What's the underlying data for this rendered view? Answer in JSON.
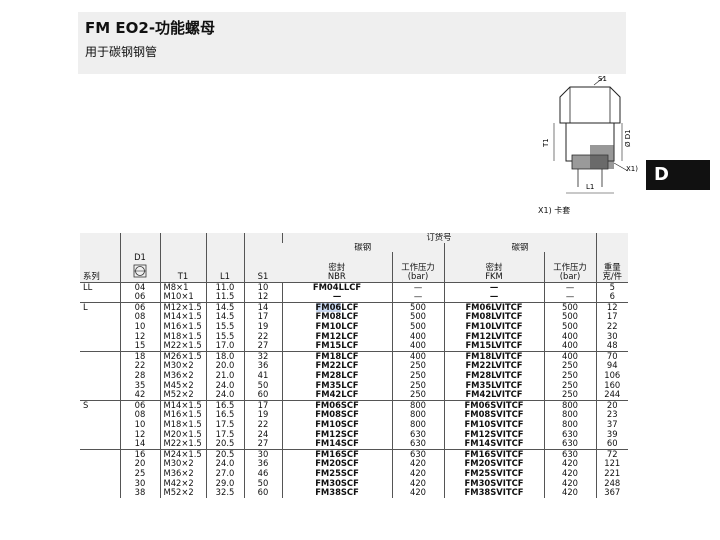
{
  "header": {
    "title": "FM EO2-功能螺母",
    "subtitle": "用于碳钢钢管"
  },
  "section_tab": "D",
  "drawing": {
    "labels": {
      "s1": "S1",
      "t1": "T1",
      "d1": "Ø D1",
      "l1": "L1",
      "x1": "X1)"
    },
    "note": "X1) 卡套"
  },
  "table": {
    "headers": {
      "order_no": "订货号",
      "carbon_steel_left": "碳钢",
      "carbon_steel_right": "碳钢",
      "series": "系列",
      "d1": "D1",
      "t1": "T1",
      "l1": "L1",
      "s1": "S1",
      "seal_nbr_1": "密封",
      "seal_nbr_2": "NBR",
      "pressure_1": "工作压力",
      "pressure_2": "(bar)",
      "seal_fkm_1": "密封",
      "seal_fkm_2": "FKM",
      "pressure_fkm_1": "工作压力",
      "pressure_fkm_2": "(bar)",
      "weight_1": "重量",
      "weight_2": "克/件"
    },
    "rows": [
      {
        "series": "LL",
        "d1": "04",
        "t1": "M8×1",
        "l1": "11.0",
        "s1": "10",
        "nbr": "FM04LLCF",
        "p1": "—",
        "fkm": "—",
        "p2": "—",
        "w": "5"
      },
      {
        "series": "",
        "d1": "06",
        "t1": "M10×1",
        "l1": "11.5",
        "s1": "12",
        "nbr": "—",
        "p1": "—",
        "fkm": "—",
        "p2": "—",
        "w": "6"
      },
      {
        "series": "L",
        "d1": "06",
        "t1": "M12×1.5",
        "l1": "14.5",
        "s1": "14",
        "nbr": "FM06LCF",
        "p1": "500",
        "fkm": "FM06LVITCF",
        "p2": "500",
        "w": "12"
      },
      {
        "series": "",
        "d1": "08",
        "t1": "M14×1.5",
        "l1": "14.5",
        "s1": "17",
        "nbr": "FM08LCF",
        "p1": "500",
        "fkm": "FM08LVITCF",
        "p2": "500",
        "w": "17"
      },
      {
        "series": "",
        "d1": "10",
        "t1": "M16×1.5",
        "l1": "15.5",
        "s1": "19",
        "nbr": "FM10LCF",
        "p1": "500",
        "fkm": "FM10LVITCF",
        "p2": "500",
        "w": "22"
      },
      {
        "series": "",
        "d1": "12",
        "t1": "M18×1.5",
        "l1": "15.5",
        "s1": "22",
        "nbr": "FM12LCF",
        "p1": "400",
        "fkm": "FM12LVITCF",
        "p2": "400",
        "w": "30"
      },
      {
        "series": "",
        "d1": "15",
        "t1": "M22×1.5",
        "l1": "17.0",
        "s1": "27",
        "nbr": "FM15LCF",
        "p1": "400",
        "fkm": "FM15LVITCF",
        "p2": "400",
        "w": "48"
      },
      {
        "series": "",
        "d1": "18",
        "t1": "M26×1.5",
        "l1": "18.0",
        "s1": "32",
        "nbr": "FM18LCF",
        "p1": "400",
        "fkm": "FM18LVITCF",
        "p2": "400",
        "w": "70"
      },
      {
        "series": "",
        "d1": "22",
        "t1": "M30×2",
        "l1": "20.0",
        "s1": "36",
        "nbr": "FM22LCF",
        "p1": "250",
        "fkm": "FM22LVITCF",
        "p2": "250",
        "w": "94"
      },
      {
        "series": "",
        "d1": "28",
        "t1": "M36×2",
        "l1": "21.0",
        "s1": "41",
        "nbr": "FM28LCF",
        "p1": "250",
        "fkm": "FM28LVITCF",
        "p2": "250",
        "w": "106"
      },
      {
        "series": "",
        "d1": "35",
        "t1": "M45×2",
        "l1": "24.0",
        "s1": "50",
        "nbr": "FM35LCF",
        "p1": "250",
        "fkm": "FM35LVITCF",
        "p2": "250",
        "w": "160"
      },
      {
        "series": "",
        "d1": "42",
        "t1": "M52×2",
        "l1": "24.0",
        "s1": "60",
        "nbr": "FM42LCF",
        "p1": "250",
        "fkm": "FM42LVITCF",
        "p2": "250",
        "w": "244"
      },
      {
        "series": "S",
        "d1": "06",
        "t1": "M14×1.5",
        "l1": "16.5",
        "s1": "17",
        "nbr": "FM06SCF",
        "p1": "800",
        "fkm": "FM06SVITCF",
        "p2": "800",
        "w": "20"
      },
      {
        "series": "",
        "d1": "08",
        "t1": "M16×1.5",
        "l1": "16.5",
        "s1": "19",
        "nbr": "FM08SCF",
        "p1": "800",
        "fkm": "FM08SVITCF",
        "p2": "800",
        "w": "23"
      },
      {
        "series": "",
        "d1": "10",
        "t1": "M18×1.5",
        "l1": "17.5",
        "s1": "22",
        "nbr": "FM10SCF",
        "p1": "800",
        "fkm": "FM10SVITCF",
        "p2": "800",
        "w": "37"
      },
      {
        "series": "",
        "d1": "12",
        "t1": "M20×1.5",
        "l1": "17.5",
        "s1": "24",
        "nbr": "FM12SCF",
        "p1": "630",
        "fkm": "FM12SVITCF",
        "p2": "630",
        "w": "39"
      },
      {
        "series": "",
        "d1": "14",
        "t1": "M22×1.5",
        "l1": "20.5",
        "s1": "27",
        "nbr": "FM14SCF",
        "p1": "630",
        "fkm": "FM14SVITCF",
        "p2": "630",
        "w": "60"
      },
      {
        "series": "",
        "d1": "16",
        "t1": "M24×1.5",
        "l1": "20.5",
        "s1": "30",
        "nbr": "FM16SCF",
        "p1": "630",
        "fkm": "FM16SVITCF",
        "p2": "630",
        "w": "72"
      },
      {
        "series": "",
        "d1": "20",
        "t1": "M30×2",
        "l1": "24.0",
        "s1": "36",
        "nbr": "FM20SCF",
        "p1": "420",
        "fkm": "FM20SVITCF",
        "p2": "420",
        "w": "121"
      },
      {
        "series": "",
        "d1": "25",
        "t1": "M36×2",
        "l1": "27.0",
        "s1": "46",
        "nbr": "FM25SCF",
        "p1": "420",
        "fkm": "FM25SVITCF",
        "p2": "420",
        "w": "221"
      },
      {
        "series": "",
        "d1": "30",
        "t1": "M42×2",
        "l1": "29.0",
        "s1": "50",
        "nbr": "FM30SCF",
        "p1": "420",
        "fkm": "FM30SVITCF",
        "p2": "420",
        "w": "248"
      },
      {
        "series": "",
        "d1": "38",
        "t1": "M52×2",
        "l1": "32.5",
        "s1": "60",
        "nbr": "FM38SCF",
        "p1": "420",
        "fkm": "FM38SVITCF",
        "p2": "420",
        "w": "367"
      }
    ]
  }
}
